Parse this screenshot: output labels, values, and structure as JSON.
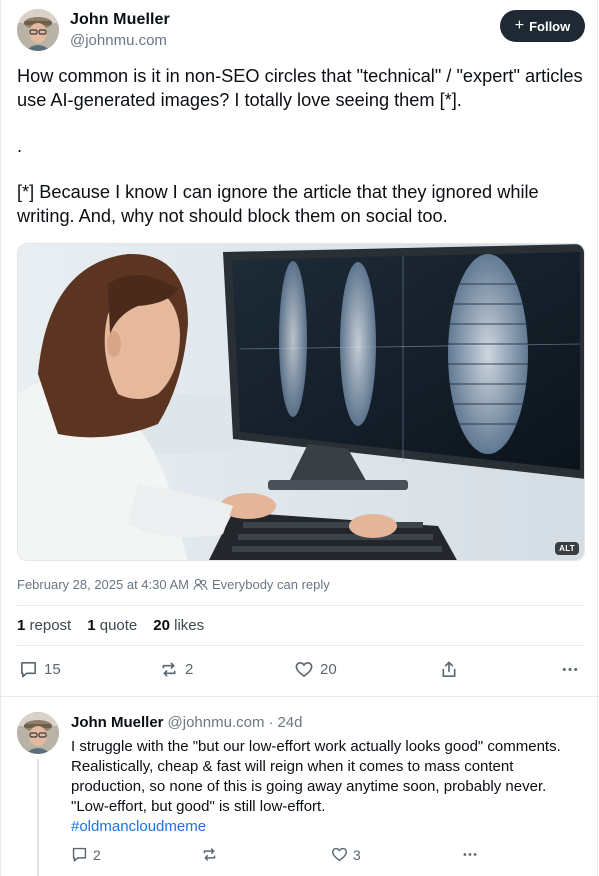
{
  "post": {
    "author_name": "John Mueller",
    "author_handle": "@johnmu.com",
    "follow_label": "Follow",
    "text_line1": "How common is it in non-SEO circles that \"technical\" / \"expert\" articles use AI-generated images? I totally love seeing them [*].",
    "text_dot": ".",
    "text_footnote": "[*] Because I know I can ignore the article that they ignored while writing. And, why not should block them on social too.",
    "image_alt_badge": "ALT",
    "timestamp": "February 28, 2025 at 4:30 AM",
    "reply_setting": "Everybody can reply",
    "stats": {
      "reposts_count": "1",
      "reposts_label": "repost",
      "quotes_count": "1",
      "quotes_label": "quote",
      "likes_count": "20",
      "likes_label": "likes"
    },
    "actions": {
      "reply_count": "15",
      "repost_count": "2",
      "like_count": "20"
    }
  },
  "reply": {
    "author_name": "John Mueller",
    "author_handle": "@johnmu.com",
    "separator": "·",
    "age": "24d",
    "text": "I struggle with the \"but our low-effort work actually looks good\" comments. Realistically, cheap & fast will reign when it comes to mass content production, so none of this is going away anytime soon, probably never. \"Low-effort, but good\" is still low-effort.",
    "hashtag": "#oldmancloudmeme",
    "actions": {
      "reply_count": "2",
      "like_count": "3"
    }
  },
  "icons": [
    "plus-icon",
    "people-icon",
    "comment-icon",
    "repost-icon",
    "heart-icon",
    "share-icon",
    "more-icon"
  ],
  "colors": {
    "follow_bg": "#1f2933",
    "link": "#1a73e8",
    "muted": "#6b7683"
  }
}
